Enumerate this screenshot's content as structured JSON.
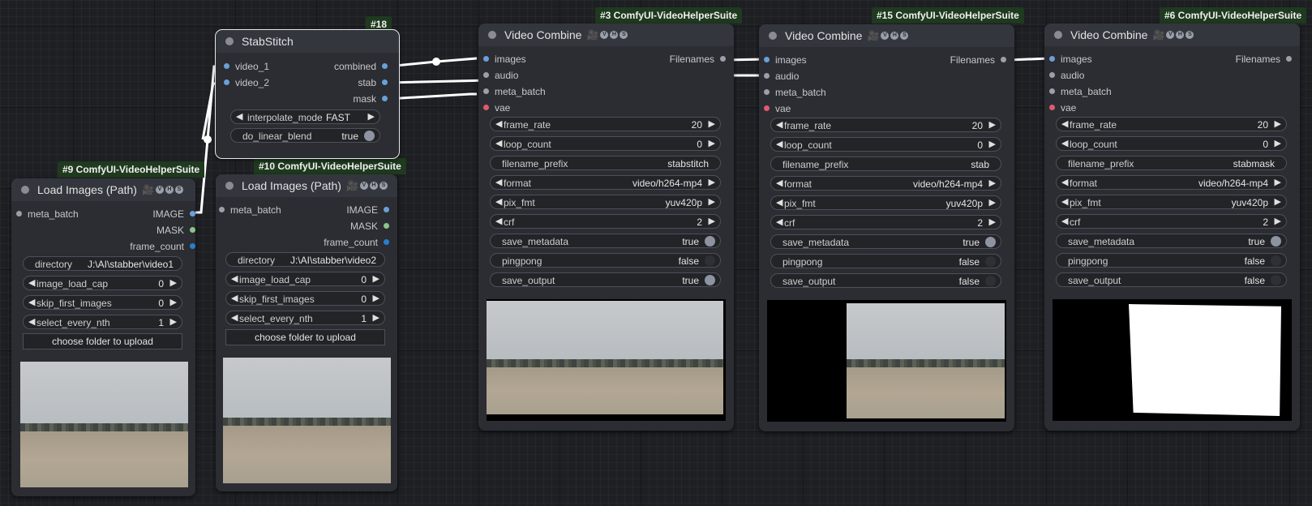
{
  "nodes": {
    "n9": {
      "badge": "#9 ComfyUI-VideoHelperSuite",
      "title": "Load Images (Path)",
      "inputs": [
        "meta_batch"
      ],
      "outputs": [
        "IMAGE",
        "MASK",
        "frame_count"
      ],
      "directory_label": "directory",
      "directory_value": "J:\\AI\\stabber\\video1",
      "widgets": [
        {
          "label": "image_load_cap",
          "value": "0"
        },
        {
          "label": "skip_first_images",
          "value": "0"
        },
        {
          "label": "select_every_nth",
          "value": "1"
        }
      ],
      "button": "choose folder to upload"
    },
    "n10": {
      "badge": "#10 ComfyUI-VideoHelperSuite",
      "title": "Load Images (Path)",
      "inputs": [
        "meta_batch"
      ],
      "outputs": [
        "IMAGE",
        "MASK",
        "frame_count"
      ],
      "directory_label": "directory",
      "directory_value": "J:\\AI\\stabber\\video2",
      "widgets": [
        {
          "label": "image_load_cap",
          "value": "0"
        },
        {
          "label": "skip_first_images",
          "value": "0"
        },
        {
          "label": "select_every_nth",
          "value": "1"
        }
      ],
      "button": "choose folder to upload"
    },
    "n18": {
      "badge": "#18",
      "title": "StabStitch",
      "inputs": [
        "video_1",
        "video_2"
      ],
      "outputs": [
        "combined",
        "stab",
        "mask"
      ],
      "interpolate_label": "interpolate_mode",
      "interpolate_value": "FAST",
      "blend_label": "do_linear_blend",
      "blend_value": "true"
    },
    "n3": {
      "badge": "#3 ComfyUI-VideoHelperSuite",
      "title": "Video Combine",
      "inputs": [
        "images",
        "audio",
        "meta_batch",
        "vae"
      ],
      "output": "Filenames",
      "frame_rate": "20",
      "loop_count": "0",
      "filename_prefix": "stabstitch",
      "format": "video/h264-mp4",
      "pix_fmt": "yuv420p",
      "crf": "2",
      "save_metadata": "true",
      "pingpong": "false",
      "save_output": "true"
    },
    "n15": {
      "badge": "#15 ComfyUI-VideoHelperSuite",
      "title": "Video Combine",
      "inputs": [
        "images",
        "audio",
        "meta_batch",
        "vae"
      ],
      "output": "Filenames",
      "frame_rate": "20",
      "loop_count": "0",
      "filename_prefix": "stab",
      "format": "video/h264-mp4",
      "pix_fmt": "yuv420p",
      "crf": "2",
      "save_metadata": "true",
      "pingpong": "false",
      "save_output": "false"
    },
    "n6": {
      "badge": "#6 ComfyUI-VideoHelperSuite",
      "title": "Video Combine",
      "inputs": [
        "images",
        "audio",
        "meta_batch",
        "vae"
      ],
      "output": "Filenames",
      "frame_rate": "20",
      "loop_count": "0",
      "filename_prefix": "stabmask",
      "format": "video/h264-mp4",
      "pix_fmt": "yuv420p",
      "crf": "2",
      "save_metadata": "true",
      "pingpong": "false",
      "save_output": "false"
    }
  },
  "labels": {
    "frame_rate": "frame_rate",
    "loop_count": "loop_count",
    "filename_prefix": "filename_prefix",
    "format": "format",
    "pix_fmt": "pix_fmt",
    "crf": "crf",
    "save_metadata": "save_metadata",
    "pingpong": "pingpong",
    "save_output": "save_output"
  },
  "vhs_icon": "film-camera-icon",
  "colors": {
    "image_slot": "#6aa0d8",
    "mask_slot": "#8ac48a",
    "int_slot": "#2a7dd0",
    "vae_slot": "#e05a6c",
    "badge_bg": "#1f3a1f"
  }
}
